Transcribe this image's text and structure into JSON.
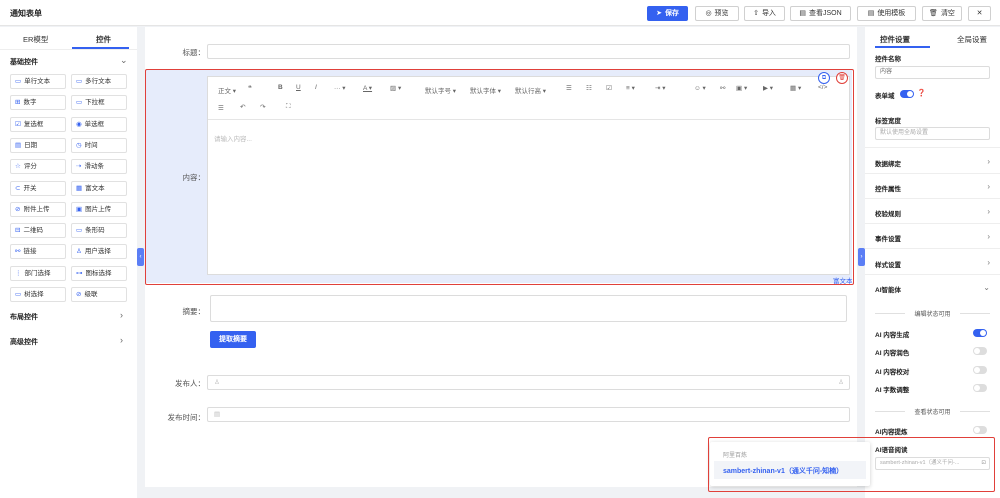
{
  "topbar": {
    "title": "通知表单",
    "save": "保存",
    "preview": "预览",
    "import": "导入",
    "view_json": "查看JSON",
    "use_template": "使用模板",
    "clear": "清空",
    "close": "✕"
  },
  "left": {
    "tabs": [
      "ER模型",
      "控件"
    ],
    "basic_section": "基础控件",
    "widgets": [
      {
        "icon": "▭",
        "label": "单行文本"
      },
      {
        "icon": "▭",
        "label": "多行文本"
      },
      {
        "icon": "⊞",
        "label": "数字"
      },
      {
        "icon": "▭",
        "label": "下拉框"
      },
      {
        "icon": "☑",
        "label": "复选框"
      },
      {
        "icon": "◉",
        "label": "单选框"
      },
      {
        "icon": "▤",
        "label": "日期"
      },
      {
        "icon": "◷",
        "label": "时间"
      },
      {
        "icon": "☆",
        "label": "评分"
      },
      {
        "icon": "⇢",
        "label": "滑动条"
      },
      {
        "icon": "⊂",
        "label": "开关"
      },
      {
        "icon": "▦",
        "label": "富文本"
      },
      {
        "icon": "⊘",
        "label": "附件上传"
      },
      {
        "icon": "▣",
        "label": "图片上传"
      },
      {
        "icon": "⊟",
        "label": "二维码"
      },
      {
        "icon": "▭",
        "label": "条形码"
      },
      {
        "icon": "⚯",
        "label": "链接"
      },
      {
        "icon": "♙",
        "label": "用户选择"
      },
      {
        "icon": "⋮",
        "label": "部门选择"
      },
      {
        "icon": "⊶",
        "label": "图标选择"
      },
      {
        "icon": "▭",
        "label": "树选择"
      },
      {
        "icon": "⊘",
        "label": "级联"
      }
    ],
    "layout_section": "布局控件",
    "advanced_section": "高级控件"
  },
  "form": {
    "title_label": "标题：",
    "content_label": "内容：",
    "content_placeholder": "请输入内容...",
    "rich_text_tag": "富文本",
    "summary_label": "摘要：",
    "extract_button": "提取摘要",
    "publisher_label": "发布人：",
    "publish_time_label": "发布时间："
  },
  "toolbar": {
    "paragraph": "正文",
    "font_size": "默认字号",
    "font_family": "默认字体",
    "line_height": "默认行高"
  },
  "right": {
    "tabs": [
      "控件设置",
      "全局设置"
    ],
    "widget_name_label": "控件名称",
    "widget_name_value": "内容",
    "form_field_label": "表单域",
    "label_width_label": "标签宽度",
    "label_width_placeholder": "默认使用全局设置",
    "sections": [
      "数据绑定",
      "控件属性",
      "校验规则",
      "事件设置",
      "样式设置",
      "AI智能体"
    ],
    "edit_state_header": "编辑状态可用",
    "ai_generate": "AI 内容生成",
    "ai_polish": "AI 内容润色",
    "ai_proofread": "AI 内容校对",
    "ai_wordcount": "AI 字数调整",
    "view_state_header": "查看状态可用",
    "ai_extract": "AI内容提炼",
    "ai_read": "AI语音阅读",
    "voice_value": "sambert-zhinan-v1（通义千问-..."
  },
  "popup": {
    "header": "阿里百炼",
    "option": "sambert-zhinan-v1（通义千问-知楠）"
  },
  "colors": {
    "accent": "#3461f0",
    "highlight": "#e0403a"
  }
}
